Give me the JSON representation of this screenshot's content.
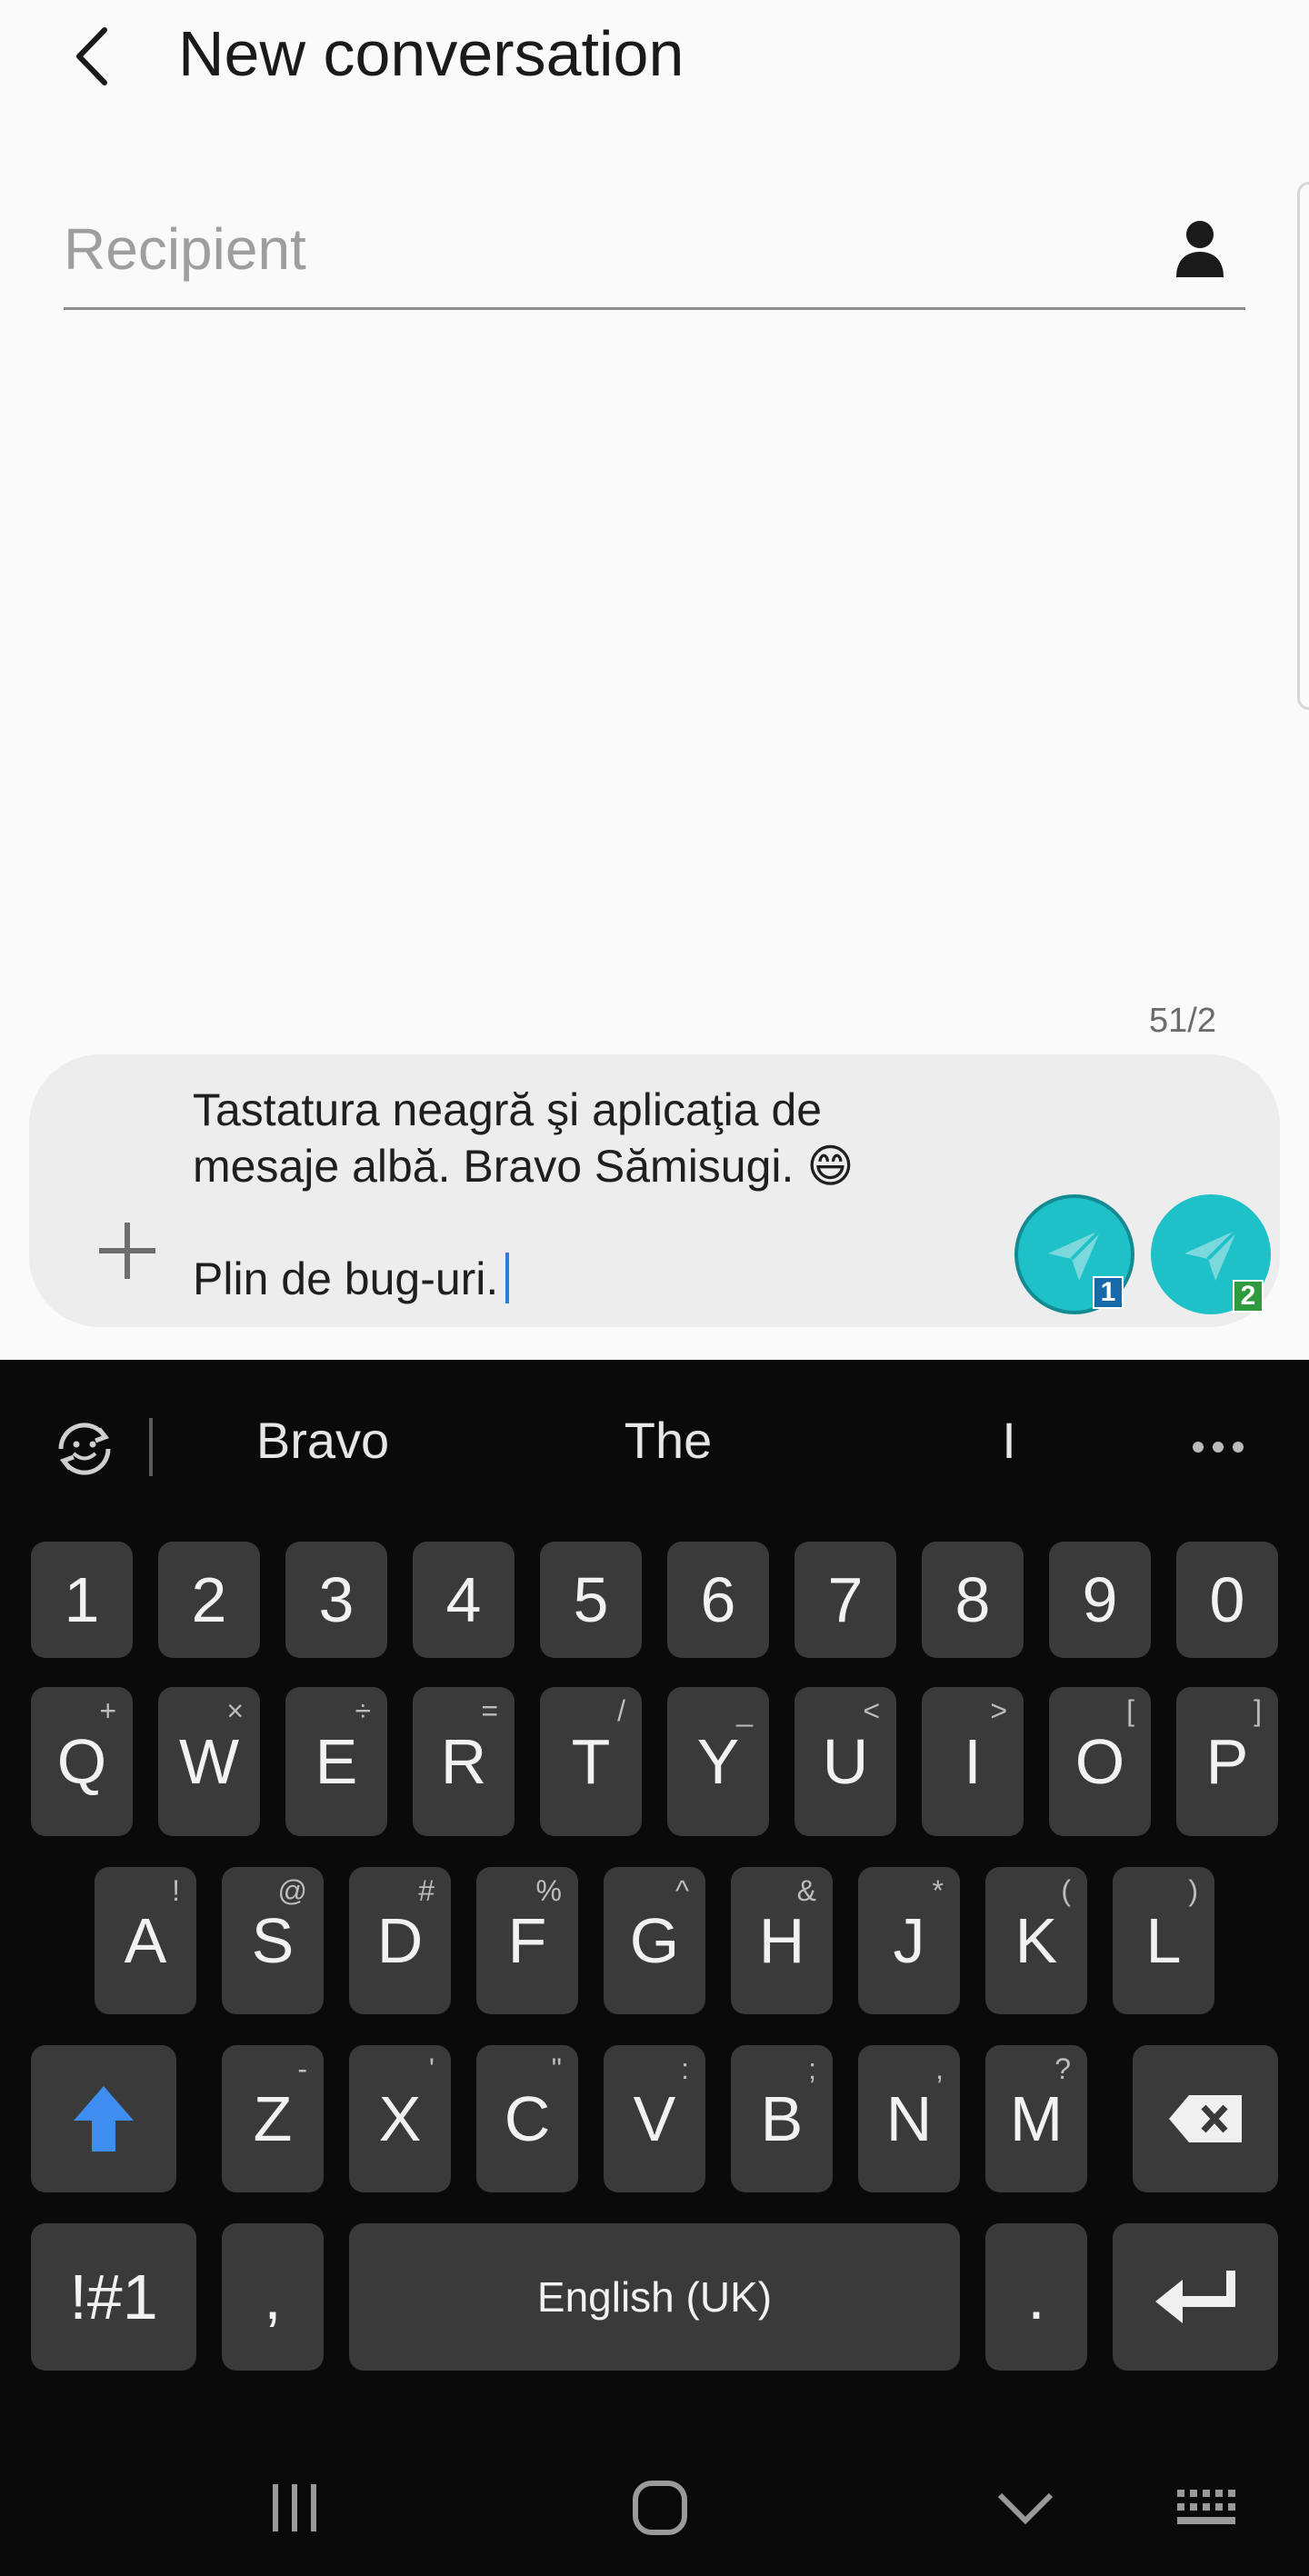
{
  "header": {
    "title": "New conversation"
  },
  "recipient": {
    "placeholder": "Recipient",
    "value": ""
  },
  "counter": "51/2",
  "message": {
    "text": "Tastatura neagră şi aplicaţia de\nmesaje albă. Bravo Sămisugi. 😄\n\nPlin de bug-uri."
  },
  "send": {
    "sim1_label": "1",
    "sim2_label": "2",
    "accent": "#1fc1c8"
  },
  "keyboard": {
    "suggestions": [
      "Bravo",
      "The",
      "I"
    ],
    "row_numbers": [
      "1",
      "2",
      "3",
      "4",
      "5",
      "6",
      "7",
      "8",
      "9",
      "0"
    ],
    "row_q": [
      {
        "k": "Q",
        "h": "+"
      },
      {
        "k": "W",
        "h": "×"
      },
      {
        "k": "E",
        "h": "÷"
      },
      {
        "k": "R",
        "h": "="
      },
      {
        "k": "T",
        "h": "/"
      },
      {
        "k": "Y",
        "h": "_"
      },
      {
        "k": "U",
        "h": "<"
      },
      {
        "k": "I",
        "h": ">"
      },
      {
        "k": "O",
        "h": "["
      },
      {
        "k": "P",
        "h": "]"
      }
    ],
    "row_a": [
      {
        "k": "A",
        "h": "!"
      },
      {
        "k": "S",
        "h": "@"
      },
      {
        "k": "D",
        "h": "#"
      },
      {
        "k": "F",
        "h": "%"
      },
      {
        "k": "G",
        "h": "^"
      },
      {
        "k": "H",
        "h": "&"
      },
      {
        "k": "J",
        "h": "*"
      },
      {
        "k": "K",
        "h": "("
      },
      {
        "k": "L",
        "h": ")"
      }
    ],
    "row_z": [
      {
        "k": "Z",
        "h": "-"
      },
      {
        "k": "X",
        "h": "'"
      },
      {
        "k": "C",
        "h": "\""
      },
      {
        "k": "V",
        "h": ":"
      },
      {
        "k": "B",
        "h": ";"
      },
      {
        "k": "N",
        "h": ","
      },
      {
        "k": "M",
        "h": "?"
      }
    ],
    "symbols_label": "!#1",
    "comma_label": ",",
    "space_label": "English (UK)",
    "period_label": ".",
    "shift_color": "#3d8ef0"
  }
}
